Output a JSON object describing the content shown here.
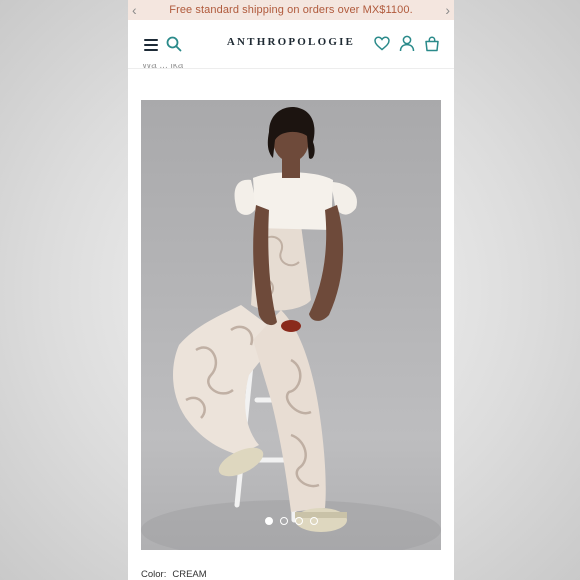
{
  "promo": {
    "text": "Free standard shipping on orders over MX$1100.",
    "prev_icon": "chevron-left-icon",
    "next_icon": "chevron-right-icon"
  },
  "header": {
    "logo": "ANTHROPOLOGIE",
    "menu_icon": "hamburger-menu-icon",
    "search_icon": "search-icon",
    "wishlist_icon": "heart-icon",
    "account_icon": "account-icon",
    "bag_icon": "shopping-bag-icon",
    "accent": "#2a8a8a"
  },
  "breadcrumb": {
    "text": "Wa ... lka"
  },
  "gallery": {
    "slides": 4,
    "active_slide": 1
  },
  "product": {
    "color_label": "Color:",
    "color_value": "CREAM"
  },
  "colors": {
    "promo_bg": "#f4e6df",
    "promo_text": "#b05a3c",
    "logo": "#1f2a33"
  }
}
